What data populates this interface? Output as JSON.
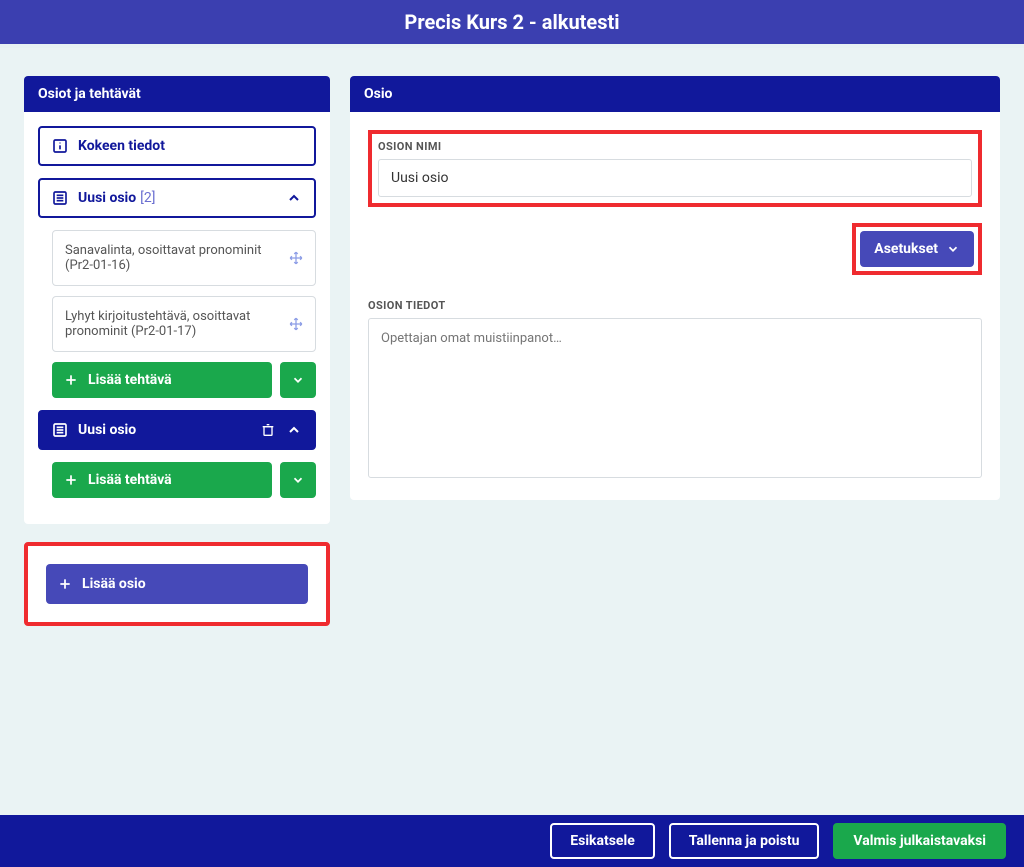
{
  "header": {
    "title": "Precis Kurs 2 - alkutesti"
  },
  "sidebar": {
    "title": "Osiot ja tehtävät",
    "exam_info_label": "Kokeen tiedot",
    "sections": [
      {
        "label": "Uusi osio",
        "count": "[2]",
        "expanded": true,
        "tasks": [
          {
            "label": "Sanavalinta, osoittavat pronominit (Pr2-01-16)"
          },
          {
            "label": "Lyhyt kirjoitustehtävä, osoittavat pronominit (Pr2-01-17)"
          }
        ],
        "add_task_label": "Lisää tehtävä"
      },
      {
        "label": "Uusi osio",
        "expanded": true,
        "active": true,
        "tasks": [],
        "add_task_label": "Lisää tehtävä"
      }
    ],
    "add_section_label": "Lisää osio"
  },
  "content": {
    "title": "Osio",
    "name_label": "OSION NIMI",
    "name_value": "Uusi osio",
    "settings_label": "Asetukset",
    "details_label": "OSION TIEDOT",
    "details_placeholder": "Opettajan omat muistiinpanot…"
  },
  "footer": {
    "preview": "Esikatsele",
    "save_exit": "Tallenna ja poistu",
    "publish": "Valmis julkaistavaksi"
  }
}
